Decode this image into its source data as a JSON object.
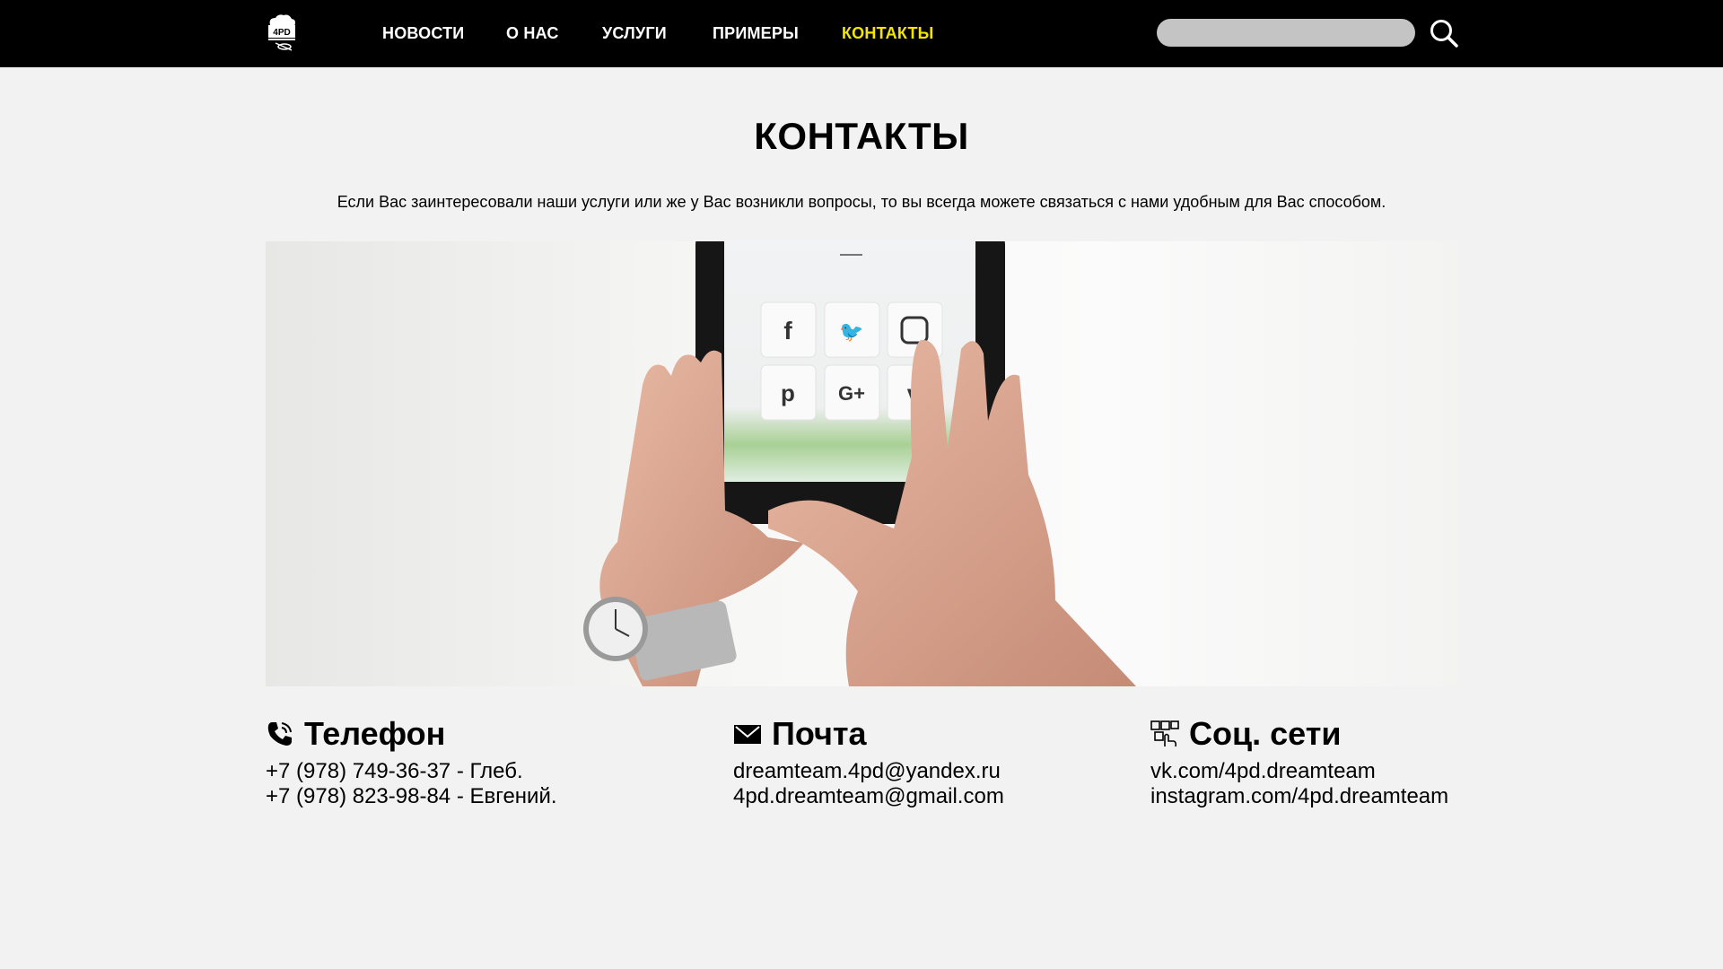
{
  "nav": {
    "logo_text": "4PD",
    "items": [
      {
        "label": "НОВОСТИ"
      },
      {
        "label": "О НАС"
      },
      {
        "label": "УСЛУГИ"
      },
      {
        "label": "ПРИМЕРЫ"
      },
      {
        "label": "КОНТАКТЫ",
        "active": true
      }
    ],
    "search_placeholder": ""
  },
  "colors": {
    "topbar": "#000000",
    "active_nav": "#f2e600",
    "background": "#f2f2f2",
    "search_field": "#c4c4c4"
  },
  "page": {
    "title": "КОНТАКТЫ",
    "intro": "Если Вас заинтересовали наши услуги или же у Вас возникли вопросы, то вы всегда можете связаться с нами удобным для Вас способом."
  },
  "contacts": {
    "phone": {
      "icon": "phone-icon",
      "title": "Телефон",
      "lines": [
        "+7 (978) 749-36-37 - Глеб.",
        "+7 (978) 823-98-84 - Евгений."
      ]
    },
    "mail": {
      "icon": "envelope-icon",
      "title": "Почта",
      "lines": [
        "dreamteam.4pd@yandex.ru",
        "4pd.dreamteam@gmail.com"
      ]
    },
    "social": {
      "icon": "social-network-icon",
      "title": "Соц. сети",
      "lines": [
        "vk.com/4pd.dreamteam",
        "instagram.com/4pd.dreamteam"
      ]
    }
  }
}
